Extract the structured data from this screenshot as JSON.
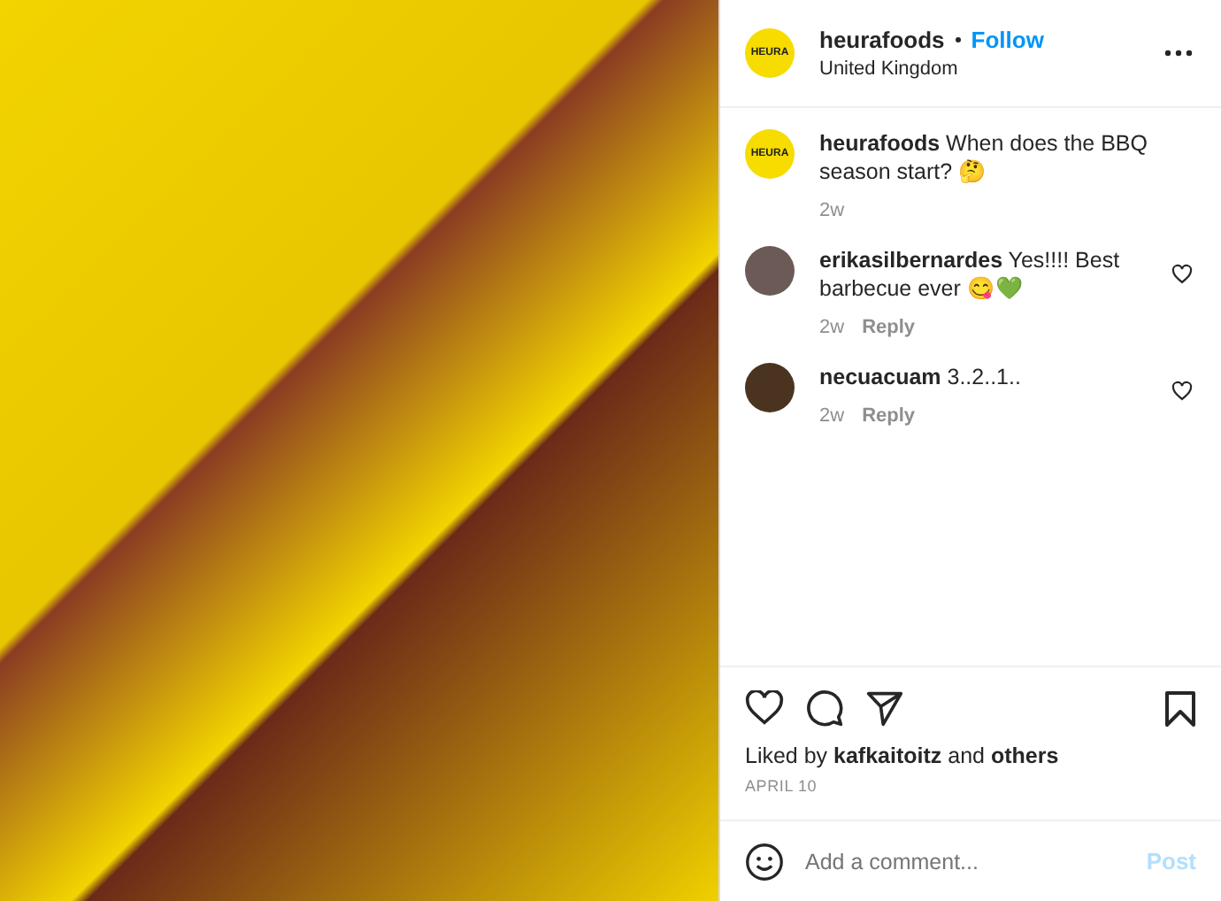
{
  "post": {
    "username": "heurafoods",
    "follow": "Follow",
    "location": "United Kingdom",
    "logo_text": "HEURA"
  },
  "comments": [
    {
      "kind": "caption",
      "logo_text": "HEURA",
      "text": "**heurafoods** When does the BBQ season start? 🤔",
      "time": "2w"
    },
    {
      "kind": "reply",
      "text": "**erikasilbernardes** Yes!!!! Best barbecue ever 😋💚",
      "time": "2w",
      "reply": "Reply"
    },
    {
      "kind": "reply",
      "text": "**necuacuam** 3..2..1..",
      "time": "2w",
      "reply": "Reply"
    }
  ],
  "likes": "Liked by **kafkaitoitz** and **others**",
  "date": "APRIL 10",
  "comment_box": {
    "placeholder": "Add a comment...",
    "post": "Post",
    "disabled": true
  }
}
